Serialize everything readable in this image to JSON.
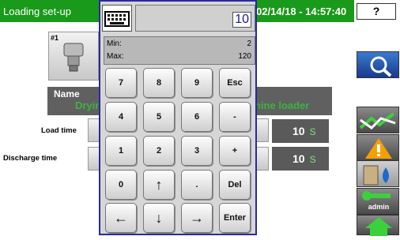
{
  "header": {
    "title": "Loading set-up",
    "datetime": "02/14/18 - 14:57:40",
    "help_label": "?"
  },
  "machine": {
    "number": "#1"
  },
  "name_section": {
    "label": "Name",
    "value_left": "Dryin",
    "value_right": "hine loader"
  },
  "rows": [
    {
      "label": "Load time",
      "value": "10",
      "unit": "S"
    },
    {
      "label": "Discharge time",
      "value": "10",
      "unit": "S"
    }
  ],
  "side": {
    "user_label": "admin"
  },
  "keypad": {
    "value": "10",
    "min_label": "Min:",
    "min_value": "2",
    "max_label": "Max:",
    "max_value": "120",
    "keys": [
      "7",
      "8",
      "9",
      "Esc",
      "4",
      "5",
      "6",
      "-",
      "1",
      "2",
      "3",
      "+",
      "0",
      "↑",
      ".",
      "Del",
      "←",
      "↓",
      "→",
      "Enter"
    ]
  },
  "colors": {
    "header_green": "#1a9a1a",
    "name_green": "#3cb43c",
    "keypad_border": "#2a2a9a"
  }
}
